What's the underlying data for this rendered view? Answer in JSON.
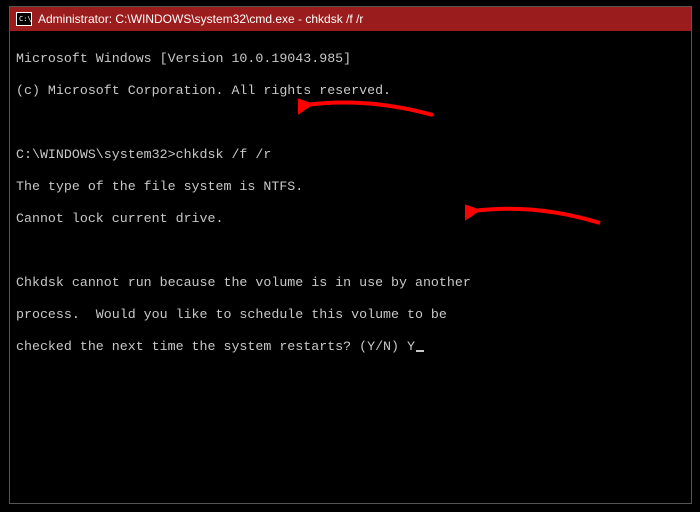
{
  "titlebar": {
    "icon_label": "C:\\",
    "title": "Administrator: C:\\WINDOWS\\system32\\cmd.exe - chkdsk  /f /r"
  },
  "terminal": {
    "line_version": "Microsoft Windows [Version 10.0.19043.985]",
    "line_copyright": "(c) Microsoft Corporation. All rights reserved.",
    "prompt": "C:\\WINDOWS\\system32>",
    "command": "chkdsk /f /r",
    "line_fs": "The type of the file system is NTFS.",
    "line_lock": "Cannot lock current drive.",
    "line_busy1": "Chkdsk cannot run because the volume is in use by another",
    "line_busy2": "process.  Would you like to schedule this volume to be",
    "line_busy3_prefix": "checked the next time the system restarts? (Y/N) ",
    "user_input": "Y"
  },
  "colors": {
    "titlebar_bg": "#9b1c1c",
    "terminal_bg": "#000000",
    "terminal_fg": "#c8c8c8",
    "arrow": "#ff0000"
  }
}
